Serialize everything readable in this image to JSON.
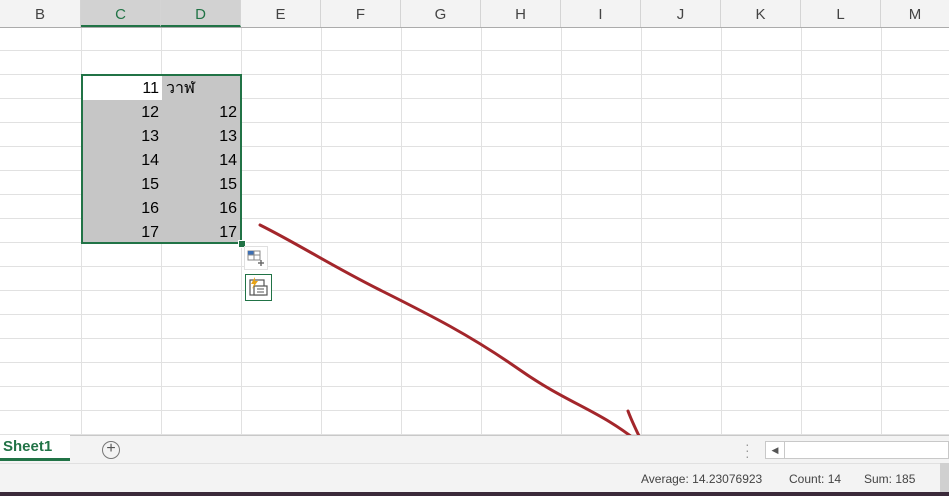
{
  "columns": [
    "B",
    "C",
    "D",
    "E",
    "F",
    "G",
    "H",
    "I",
    "J",
    "K",
    "L",
    "M"
  ],
  "cells": {
    "c_values": [
      "11",
      "12",
      "13",
      "14",
      "15",
      "16",
      "17"
    ],
    "d_header": "วาฬ",
    "d_values": [
      "12",
      "13",
      "14",
      "15",
      "16",
      "17"
    ]
  },
  "sheet": {
    "tab_label": "Sheet1",
    "add_symbol": "+"
  },
  "status": {
    "average": "Average: 14.23076923",
    "count": "Count: 14",
    "sum": "Sum: 185"
  },
  "icons": {
    "quick_analysis": "quick-analysis-icon",
    "paste_options": "paste-options-icon",
    "scroll_left": "◀"
  },
  "colors": {
    "excel_green": "#217346",
    "selection_fill": "#c6c6c6",
    "annotation_arrow": "#a3262b"
  }
}
